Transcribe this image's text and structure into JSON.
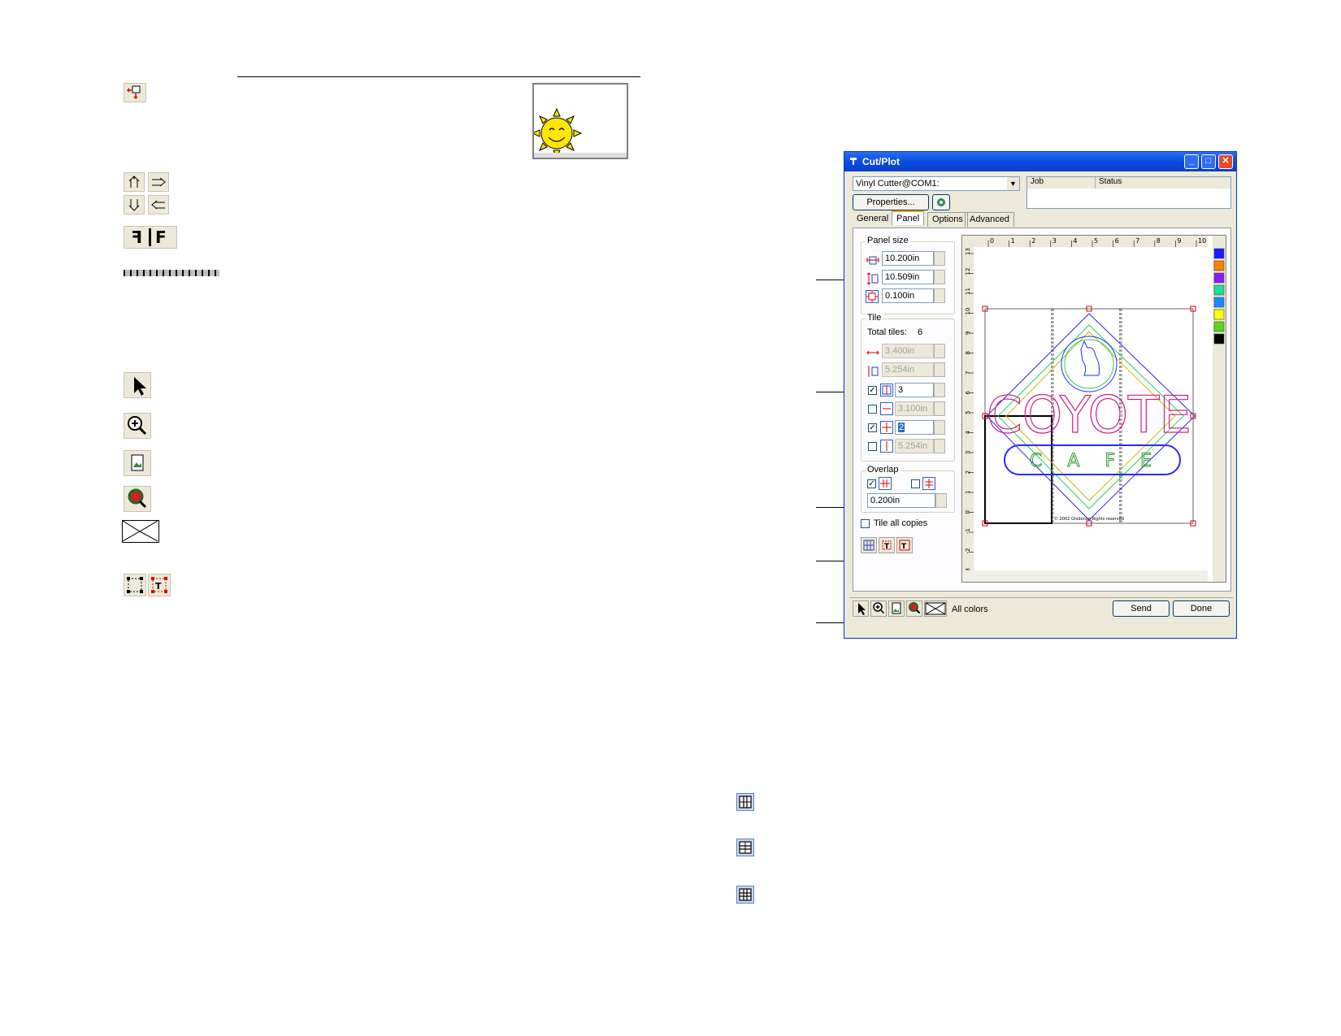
{
  "dialog": {
    "title": "Cut/Plot",
    "device": "Vinyl Cutter@COM1:",
    "properties_label": "Properties...",
    "job_col": "Job",
    "status_col": "Status",
    "tabs": [
      "General",
      "Panel",
      "Options",
      "Advanced"
    ],
    "active_tab": "Panel",
    "panel_size": {
      "label": "Panel size",
      "width": "10.200in",
      "height": "10.509in",
      "margin": "0.100in"
    },
    "tile": {
      "label": "Tile",
      "total_label": "Total tiles:",
      "total_value": "6",
      "width": "3.400in",
      "height": "5.254in",
      "columns": "3",
      "col_width": "3.100in",
      "rows": "2",
      "row_height": "5.254in"
    },
    "overlap": {
      "label": "Overlap",
      "value": "0.200in"
    },
    "tile_all_copies": "Tile all copies",
    "all_colors": "All colors",
    "send": "Send",
    "done": "Done",
    "ruler_h": [
      "0",
      "1",
      "2",
      "3",
      "4",
      "5",
      "6",
      "7",
      "8",
      "9",
      "10"
    ],
    "ruler_v": [
      "13",
      "12",
      "11",
      "10",
      "9",
      "8",
      "7",
      "6",
      "5",
      "4",
      "3",
      "2",
      "1",
      "0",
      "-1",
      "-2",
      "-3"
    ],
    "swatch_colors": [
      "#1a1aff",
      "#ff7f00",
      "#8a1aff",
      "#1ae0a0",
      "#1a8aff",
      "#ffff00",
      "#5ad61a",
      "#000000"
    ],
    "artwork": {
      "word1": "COYOTE",
      "word2": "CAFE",
      "footer": "© 2002 Ghidonon Rights reserved"
    }
  }
}
